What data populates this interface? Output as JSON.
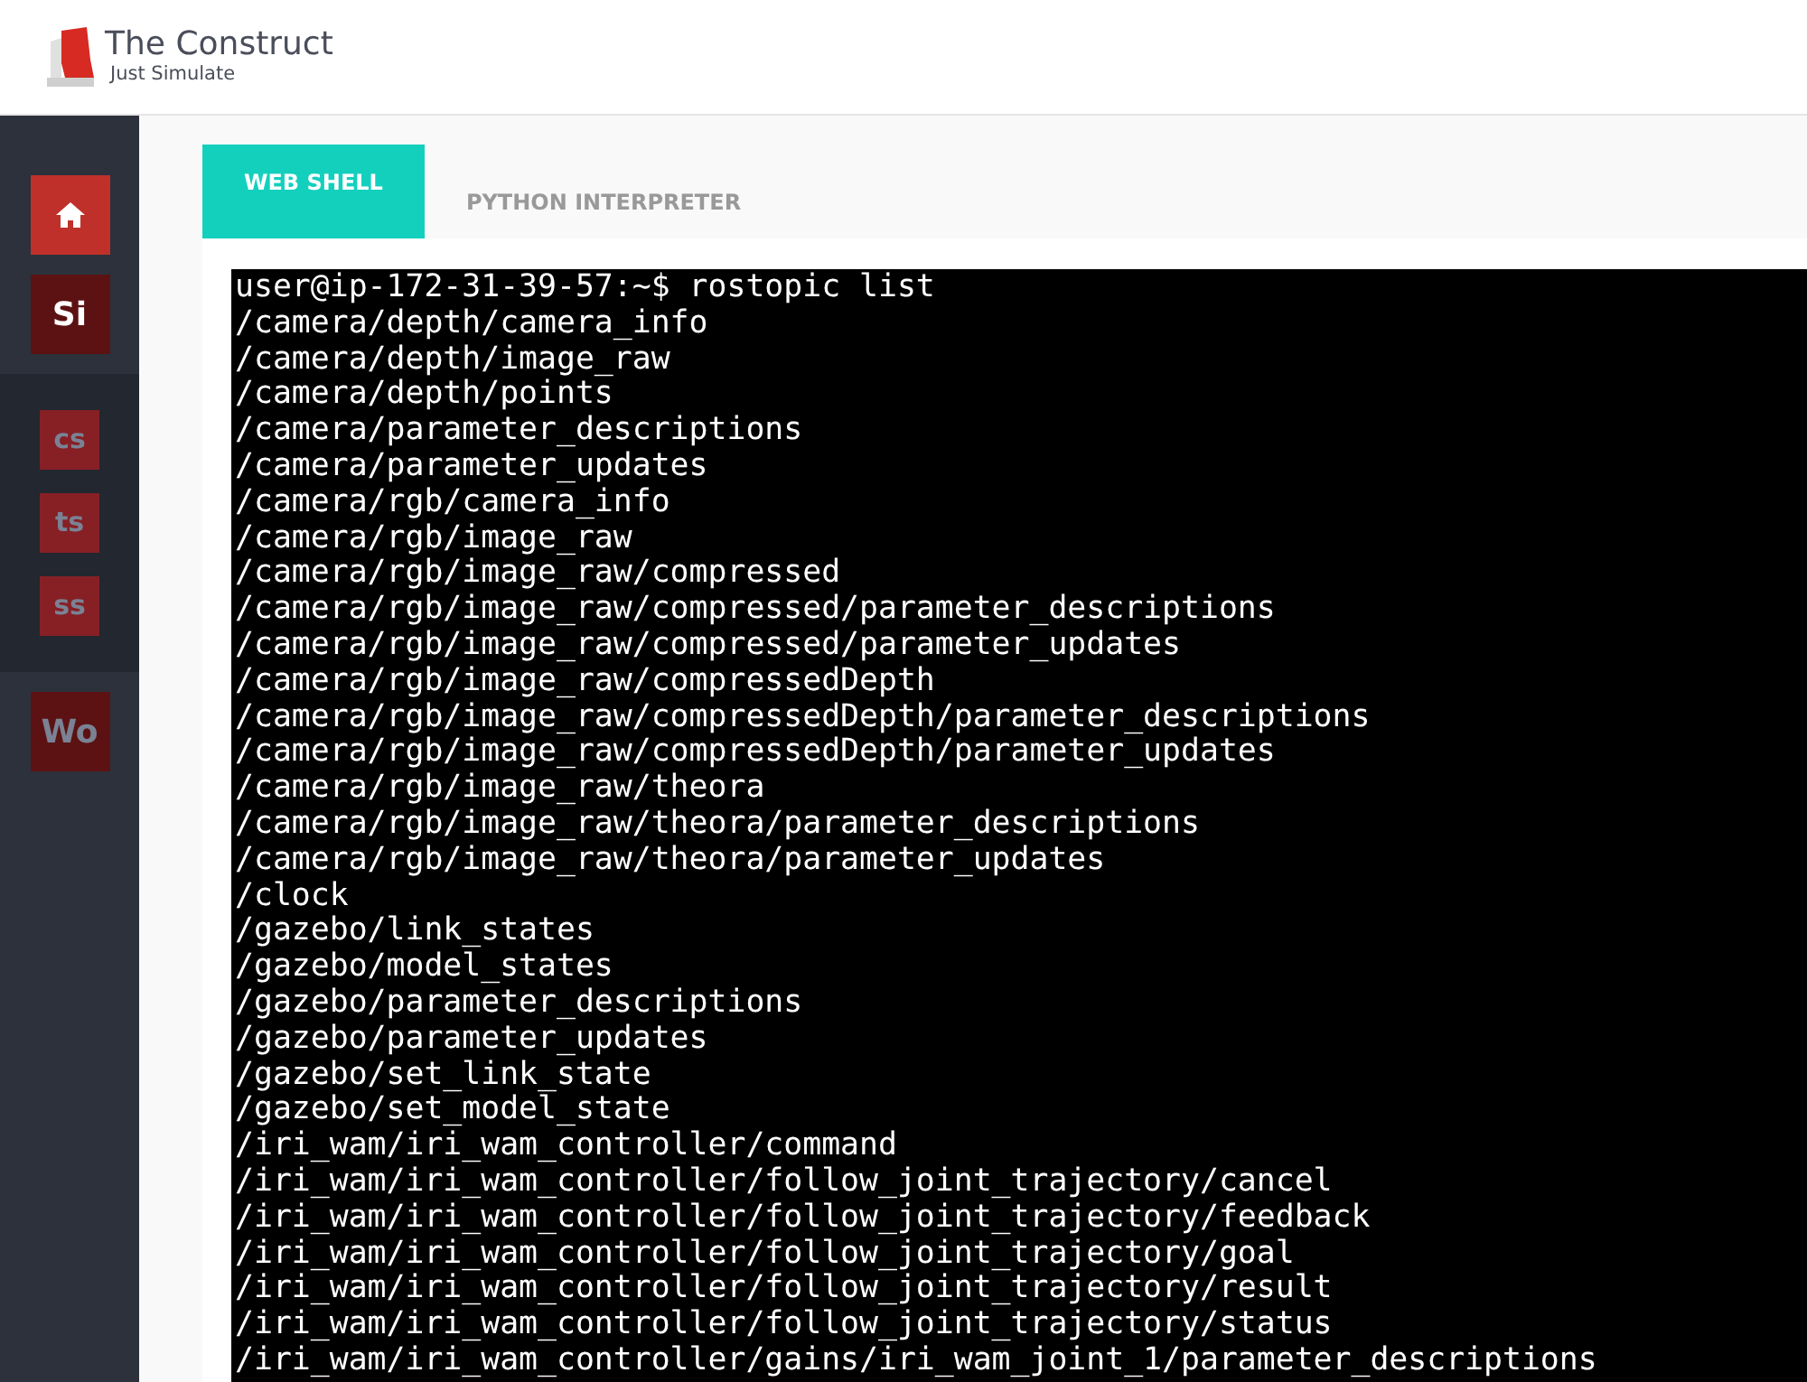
{
  "brand": {
    "name": "The Construct",
    "tagline": "Just Simulate"
  },
  "sidebar": {
    "groups": [
      {
        "items": [
          {
            "kind": "home",
            "selected": true
          },
          {
            "kind": "main",
            "label": "Si",
            "selected": true
          }
        ]
      },
      {
        "items": [
          {
            "kind": "sub",
            "label": "cs",
            "selected": false
          },
          {
            "kind": "sub",
            "label": "ts",
            "selected": false
          },
          {
            "kind": "sub",
            "label": "ss",
            "selected": false
          }
        ]
      },
      {
        "items": [
          {
            "kind": "main",
            "label": "Wo",
            "selected": false
          }
        ]
      }
    ]
  },
  "tabs": [
    {
      "label": "WEB SHELL",
      "selected": true
    },
    {
      "label": "PYTHON INTERPRETER",
      "selected": false
    }
  ],
  "terminal": {
    "lines": [
      "user@ip-172-31-39-57:~$ rostopic list",
      "/camera/depth/camera_info",
      "/camera/depth/image_raw",
      "/camera/depth/points",
      "/camera/parameter_descriptions",
      "/camera/parameter_updates",
      "/camera/rgb/camera_info",
      "/camera/rgb/image_raw",
      "/camera/rgb/image_raw/compressed",
      "/camera/rgb/image_raw/compressed/parameter_descriptions",
      "/camera/rgb/image_raw/compressed/parameter_updates",
      "/camera/rgb/image_raw/compressedDepth",
      "/camera/rgb/image_raw/compressedDepth/parameter_descriptions",
      "/camera/rgb/image_raw/compressedDepth/parameter_updates",
      "/camera/rgb/image_raw/theora",
      "/camera/rgb/image_raw/theora/parameter_descriptions",
      "/camera/rgb/image_raw/theora/parameter_updates",
      "/clock",
      "/gazebo/link_states",
      "/gazebo/model_states",
      "/gazebo/parameter_descriptions",
      "/gazebo/parameter_updates",
      "/gazebo/set_link_state",
      "/gazebo/set_model_state",
      "/iri_wam/iri_wam_controller/command",
      "/iri_wam/iri_wam_controller/follow_joint_trajectory/cancel",
      "/iri_wam/iri_wam_controller/follow_joint_trajectory/feedback",
      "/iri_wam/iri_wam_controller/follow_joint_trajectory/goal",
      "/iri_wam/iri_wam_controller/follow_joint_trajectory/result",
      "/iri_wam/iri_wam_controller/follow_joint_trajectory/status",
      "/iri_wam/iri_wam_controller/gains/iri_wam_joint_1/parameter_descriptions"
    ]
  }
}
